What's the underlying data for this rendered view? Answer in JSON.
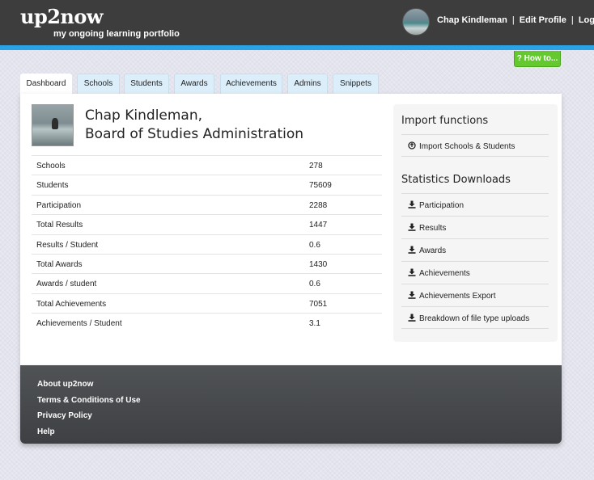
{
  "header": {
    "logo": "up2now",
    "tagline": "my ongoing learning portfolio",
    "user_name": "Chap Kindleman",
    "edit_profile": "Edit Profile",
    "logout": "Logout",
    "separator": "|",
    "howto_label": "? How to..."
  },
  "tabs": [
    {
      "label": "Dashboard",
      "active": true
    },
    {
      "label": "Schools"
    },
    {
      "label": "Students"
    },
    {
      "label": "Awards"
    },
    {
      "label": "Achievements"
    },
    {
      "label": "Admins"
    },
    {
      "label": "Snippets"
    }
  ],
  "profile": {
    "name_line1": "Chap Kindleman,",
    "name_line2": "Board of Studies Administration"
  },
  "stats": [
    {
      "label": "Schools",
      "value": "278"
    },
    {
      "label": "Students",
      "value": "75609"
    },
    {
      "label": "Participation",
      "value": "2288"
    },
    {
      "label": "Total Results",
      "value": "1447"
    },
    {
      "label": "Results / Student",
      "value": "0.6"
    },
    {
      "label": "Total Awards",
      "value": "1430"
    },
    {
      "label": "Awards / student",
      "value": "0.6"
    },
    {
      "label": "Total Achievements",
      "value": "7051"
    },
    {
      "label": "Achievements / Student",
      "value": "3.1"
    }
  ],
  "sidebar": {
    "import_title": "Import functions",
    "import_items": [
      {
        "label": "Import Schools & Students",
        "icon": "upload-circle-icon"
      }
    ],
    "downloads_title": "Statistics Downloads",
    "download_items": [
      {
        "label": "Participation",
        "icon": "download-icon"
      },
      {
        "label": "Results",
        "icon": "download-icon"
      },
      {
        "label": "Awards",
        "icon": "download-icon"
      },
      {
        "label": "Achievements",
        "icon": "download-icon"
      },
      {
        "label": "Achievements Export",
        "icon": "download-icon"
      },
      {
        "label": "Breakdown of file type uploads",
        "icon": "download-icon"
      }
    ]
  },
  "footer": {
    "links": [
      "About up2now",
      "Terms & Conditions of Use",
      "Privacy Policy",
      "Help"
    ]
  },
  "colors": {
    "header_bg": "#3d3d3d",
    "accent_bar": "#2aa3e3",
    "howto_bg": "#63c92f",
    "tab_bg": "#dceefa"
  }
}
